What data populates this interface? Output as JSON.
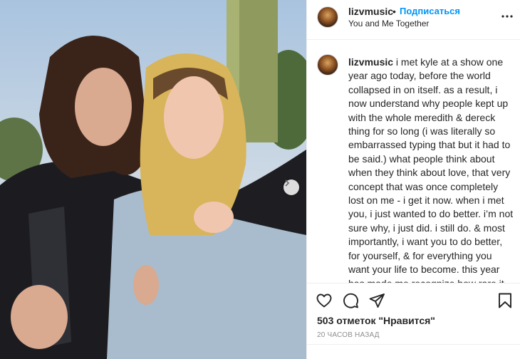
{
  "post": {
    "username": "lizvmusic",
    "follow_label": "Подписаться",
    "separator": "•",
    "location": "You and Me Together",
    "caption_user": "lizvmusic",
    "caption_text": "i met kyle at a show one year ago today, before the world collapsed in on itself. as a result, i now understand why people kept up with the whole meredith & dereck thing for so long (i was literally so embarrassed typing that but it had to be said.) what people think about when they think about love, that very concept that was once completely lost on me - i get it now. when i met you, i just wanted to do better. i’m not sure why, i just did. i still do. & most importantly, i want you to do better, for yourself, & for everything you want your life to become. this year has made me recognize how rare it is to truly wish someone well; to stop considering how someone’s choices will affect you and just hold on to the hope that they’re",
    "likes": "503 отметок \"Нравится\"",
    "timestamp": "20 часов назад"
  },
  "icons": {
    "more": "more-horizontal-icon",
    "like": "heart-icon",
    "comment": "comment-icon",
    "share": "send-icon",
    "save": "bookmark-icon",
    "next": "chevron-right-icon"
  },
  "colors": {
    "accent": "#0095f6",
    "text": "#262626",
    "muted": "#8e8e8e",
    "border": "#efefef"
  }
}
